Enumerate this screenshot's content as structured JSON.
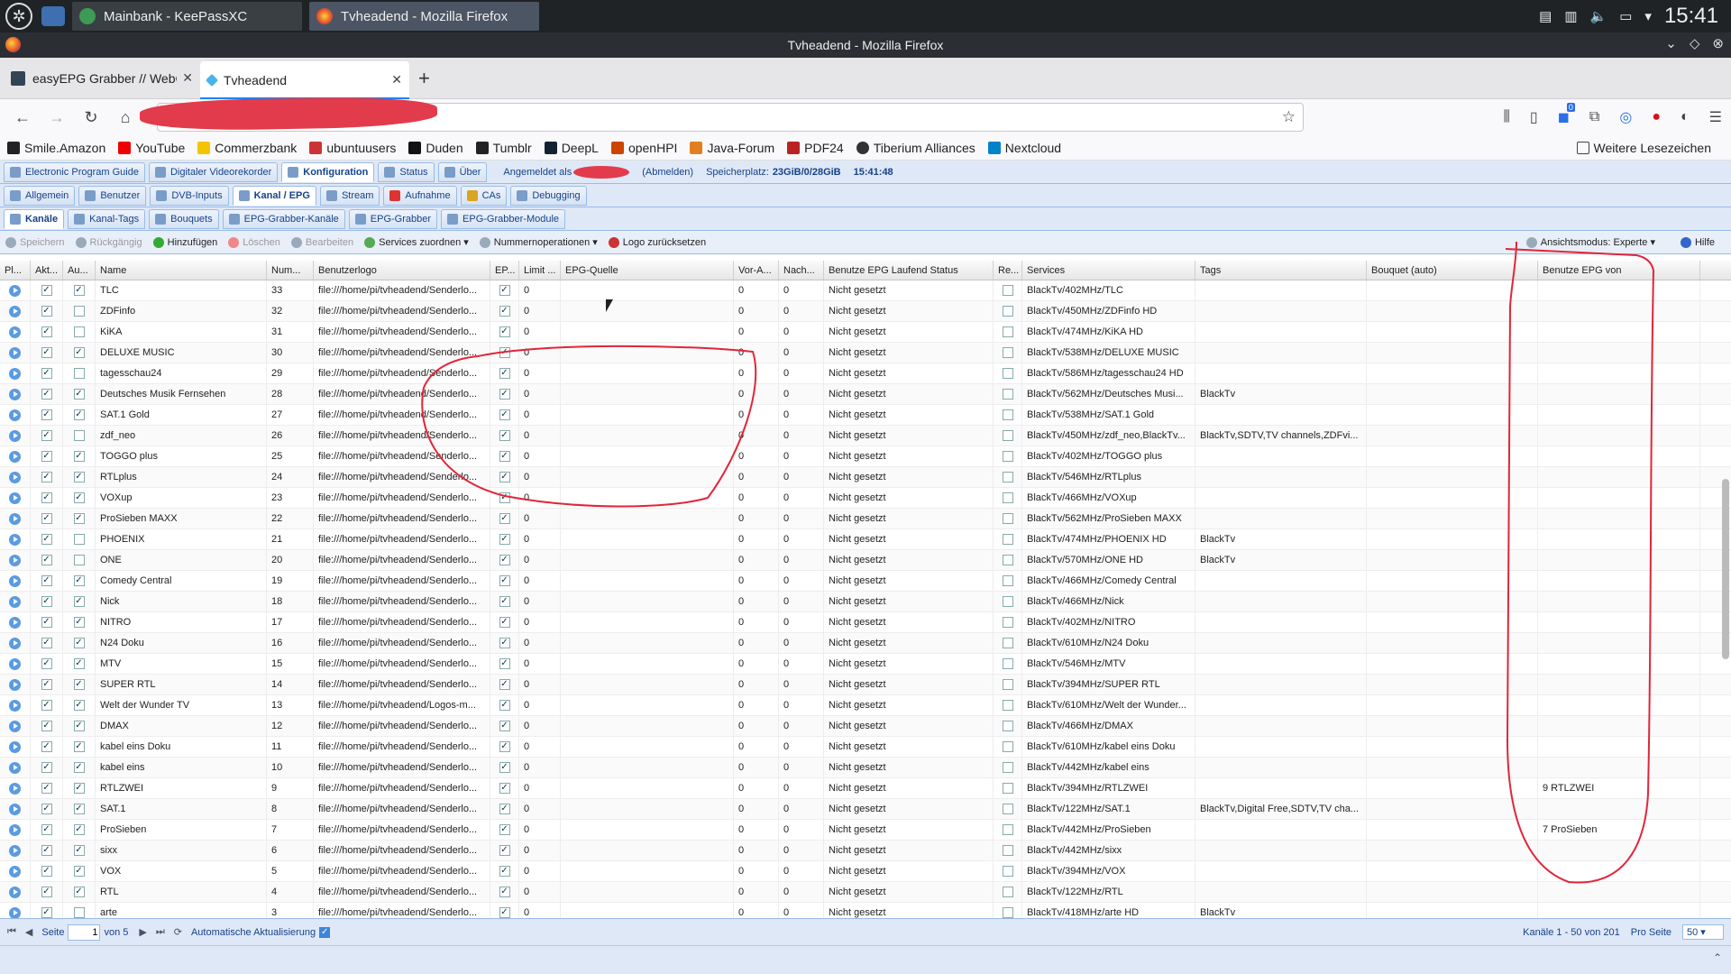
{
  "taskbar": {
    "tasks": [
      "Mainbank - KeePassXC",
      "Tvheadend - Mozilla Firefox"
    ],
    "clock": "15:41"
  },
  "window": {
    "title": "Tvheadend - Mozilla Firefox"
  },
  "browser": {
    "tabs": [
      "easyEPG Grabber // WebGr",
      "Tvheadend"
    ],
    "bookmarks": [
      "Smile.Amazon",
      "YouTube",
      "Commerzbank",
      "ubuntuusers",
      "Duden",
      "Tumblr",
      "DeepL",
      "openHPI",
      "Java-Forum",
      "PDF24",
      "Tiberium Alliances",
      "Nextcloud"
    ],
    "more_bookmarks": "Weitere Lesezeichen",
    "ext_badge": "0"
  },
  "tvh": {
    "main_tabs": [
      "Electronic Program Guide",
      "Digitaler Videorekorder",
      "Konfiguration",
      "Status",
      "Über"
    ],
    "login_label": "Angemeldet als",
    "logout": "(Abmelden)",
    "storage_label": "Speicherplatz:",
    "storage_value": "23GiB/0/28GiB",
    "time": "15:41:48",
    "config_tabs": [
      "Allgemein",
      "Benutzer",
      "DVB-Inputs",
      "Kanal / EPG",
      "Stream",
      "Aufnahme",
      "CAs",
      "Debugging"
    ],
    "sub_tabs": [
      "Kanäle",
      "Kanal-Tags",
      "Bouquets",
      "EPG-Grabber-Kanäle",
      "EPG-Grabber",
      "EPG-Grabber-Module"
    ],
    "toolbar": {
      "save": "Speichern",
      "undo": "Rückgängig",
      "add": "Hinzufügen",
      "delete": "Löschen",
      "edit": "Bearbeiten",
      "services": "Services zuordnen",
      "numops": "Nummernoperationen",
      "logo_reset": "Logo zurücksetzen",
      "view_mode": "Ansichtsmodus: Experte",
      "help": "Hilfe"
    },
    "columns": [
      "Pl...",
      "Akt...",
      "Au...",
      "Name",
      "Num...",
      "Benutzerlogo",
      "EP...",
      "Limit ...",
      "EPG-Quelle",
      "Vor-A...",
      "Nach...",
      "Benutze EPG Laufend Status",
      "Re...",
      "Services",
      "Tags",
      "Bouquet (auto)",
      "Benutze EPG von"
    ],
    "rows": [
      {
        "n": "TLC",
        "num": "33",
        "logo": "file:///home/pi/tvheadend/Senderlo...",
        "au": true,
        "svc": "BlackTv/402MHz/TLC",
        "tags": "",
        "epgvon": ""
      },
      {
        "n": "ZDFinfo",
        "num": "32",
        "logo": "file:///home/pi/tvheadend/Senderlo...",
        "au": false,
        "svc": "BlackTv/450MHz/ZDFinfo HD",
        "tags": "",
        "epgvon": ""
      },
      {
        "n": "KiKA",
        "num": "31",
        "logo": "file:///home/pi/tvheadend/Senderlo...",
        "au": false,
        "svc": "BlackTv/474MHz/KiKA HD",
        "tags": "",
        "epgvon": ""
      },
      {
        "n": "DELUXE MUSIC",
        "num": "30",
        "logo": "file:///home/pi/tvheadend/Senderlo...",
        "au": true,
        "svc": "BlackTv/538MHz/DELUXE MUSIC",
        "tags": "",
        "epgvon": ""
      },
      {
        "n": "tagesschau24",
        "num": "29",
        "logo": "file:///home/pi/tvheadend/Senderlo...",
        "au": false,
        "svc": "BlackTv/586MHz/tagesschau24 HD",
        "tags": "",
        "epgvon": ""
      },
      {
        "n": "Deutsches Musik Fernsehen",
        "num": "28",
        "logo": "file:///home/pi/tvheadend/Senderlo...",
        "au": true,
        "svc": "BlackTv/562MHz/Deutsches Musi...",
        "tags": "BlackTv",
        "epgvon": ""
      },
      {
        "n": "SAT.1 Gold",
        "num": "27",
        "logo": "file:///home/pi/tvheadend/Senderlo...",
        "au": true,
        "svc": "BlackTv/538MHz/SAT.1 Gold",
        "tags": "",
        "epgvon": ""
      },
      {
        "n": "zdf_neo",
        "num": "26",
        "logo": "file:///home/pi/tvheadend/Senderlo...",
        "au": false,
        "svc": "BlackTv/450MHz/zdf_neo,BlackTv...",
        "tags": "BlackTv,SDTV,TV channels,ZDFvi...",
        "epgvon": ""
      },
      {
        "n": "TOGGO plus",
        "num": "25",
        "logo": "file:///home/pi/tvheadend/Senderlo...",
        "au": true,
        "svc": "BlackTv/402MHz/TOGGO plus",
        "tags": "",
        "epgvon": ""
      },
      {
        "n": "RTLplus",
        "num": "24",
        "logo": "file:///home/pi/tvheadend/Senderlo...",
        "au": true,
        "svc": "BlackTv/546MHz/RTLplus",
        "tags": "",
        "epgvon": ""
      },
      {
        "n": "VOXup",
        "num": "23",
        "logo": "file:///home/pi/tvheadend/Senderlo...",
        "au": true,
        "svc": "BlackTv/466MHz/VOXup",
        "tags": "",
        "epgvon": ""
      },
      {
        "n": "ProSieben MAXX",
        "num": "22",
        "logo": "file:///home/pi/tvheadend/Senderlo...",
        "au": true,
        "svc": "BlackTv/562MHz/ProSieben MAXX",
        "tags": "",
        "epgvon": ""
      },
      {
        "n": "PHOENIX",
        "num": "21",
        "logo": "file:///home/pi/tvheadend/Senderlo...",
        "au": false,
        "svc": "BlackTv/474MHz/PHOENIX HD",
        "tags": "BlackTv",
        "epgvon": ""
      },
      {
        "n": "ONE",
        "num": "20",
        "logo": "file:///home/pi/tvheadend/Senderlo...",
        "au": false,
        "svc": "BlackTv/570MHz/ONE HD",
        "tags": "BlackTv",
        "epgvon": ""
      },
      {
        "n": "Comedy Central",
        "num": "19",
        "logo": "file:///home/pi/tvheadend/Senderlo...",
        "au": true,
        "svc": "BlackTv/466MHz/Comedy Central",
        "tags": "",
        "epgvon": ""
      },
      {
        "n": "Nick",
        "num": "18",
        "logo": "file:///home/pi/tvheadend/Senderlo...",
        "au": true,
        "svc": "BlackTv/466MHz/Nick",
        "tags": "",
        "epgvon": ""
      },
      {
        "n": "NITRO",
        "num": "17",
        "logo": "file:///home/pi/tvheadend/Senderlo...",
        "au": true,
        "svc": "BlackTv/402MHz/NITRO",
        "tags": "",
        "epgvon": ""
      },
      {
        "n": "N24 Doku",
        "num": "16",
        "logo": "file:///home/pi/tvheadend/Senderlo...",
        "au": true,
        "svc": "BlackTv/610MHz/N24 Doku",
        "tags": "",
        "epgvon": ""
      },
      {
        "n": "MTV",
        "num": "15",
        "logo": "file:///home/pi/tvheadend/Senderlo...",
        "au": true,
        "svc": "BlackTv/546MHz/MTV",
        "tags": "",
        "epgvon": ""
      },
      {
        "n": "SUPER RTL",
        "num": "14",
        "logo": "file:///home/pi/tvheadend/Senderlo...",
        "au": true,
        "svc": "BlackTv/394MHz/SUPER RTL",
        "tags": "",
        "epgvon": ""
      },
      {
        "n": "Welt der Wunder TV",
        "num": "13",
        "logo": "file:///home/pi/tvheadend/Logos-m...",
        "au": true,
        "svc": "BlackTv/610MHz/Welt der Wunder...",
        "tags": "",
        "epgvon": ""
      },
      {
        "n": "DMAX",
        "num": "12",
        "logo": "file:///home/pi/tvheadend/Senderlo...",
        "au": true,
        "svc": "BlackTv/466MHz/DMAX",
        "tags": "",
        "epgvon": ""
      },
      {
        "n": "kabel eins Doku",
        "num": "11",
        "logo": "file:///home/pi/tvheadend/Senderlo...",
        "au": true,
        "svc": "BlackTv/610MHz/kabel eins Doku",
        "tags": "",
        "epgvon": ""
      },
      {
        "n": "kabel eins",
        "num": "10",
        "logo": "file:///home/pi/tvheadend/Senderlo...",
        "au": true,
        "svc": "BlackTv/442MHz/kabel eins",
        "tags": "",
        "epgvon": ""
      },
      {
        "n": "RTLZWEI",
        "num": "9",
        "logo": "file:///home/pi/tvheadend/Senderlo...",
        "au": true,
        "svc": "BlackTv/394MHz/RTLZWEI",
        "tags": "",
        "epgvon": "9 RTLZWEI"
      },
      {
        "n": "SAT.1",
        "num": "8",
        "logo": "file:///home/pi/tvheadend/Senderlo...",
        "au": true,
        "svc": "BlackTv/122MHz/SAT.1",
        "tags": "BlackTv,Digital Free,SDTV,TV cha...",
        "epgvon": ""
      },
      {
        "n": "ProSieben",
        "num": "7",
        "logo": "file:///home/pi/tvheadend/Senderlo...",
        "au": true,
        "svc": "BlackTv/442MHz/ProSieben",
        "tags": "",
        "epgvon": "7 ProSieben"
      },
      {
        "n": "sixx",
        "num": "6",
        "logo": "file:///home/pi/tvheadend/Senderlo...",
        "au": true,
        "svc": "BlackTv/442MHz/sixx",
        "tags": "",
        "epgvon": ""
      },
      {
        "n": "VOX",
        "num": "5",
        "logo": "file:///home/pi/tvheadend/Senderlo...",
        "au": true,
        "svc": "BlackTv/394MHz/VOX",
        "tags": "",
        "epgvon": ""
      },
      {
        "n": "RTL",
        "num": "4",
        "logo": "file:///home/pi/tvheadend/Senderlo...",
        "au": true,
        "svc": "BlackTv/122MHz/RTL",
        "tags": "",
        "epgvon": ""
      },
      {
        "n": "arte",
        "num": "3",
        "logo": "file:///home/pi/tvheadend/Senderlo...",
        "au": false,
        "svc": "BlackTv/418MHz/arte HD",
        "tags": "BlackTv",
        "epgvon": ""
      }
    ],
    "cell_defaults": {
      "limit": "0",
      "pre": "0",
      "post": "0",
      "status": "Nicht gesetzt"
    },
    "pager": {
      "page_label": "Seite",
      "page": "1",
      "of": "von 5",
      "auto_refresh": "Automatische Aktualisierung",
      "range": "Kanäle 1 - 50 von 201",
      "per_page_label": "Pro Seite",
      "per_page": "50"
    }
  },
  "colors": {
    "annotation": "#e0263a",
    "ext_blue": "#2a6ee8",
    "ext_red": "#d3141e",
    "accent": "#0a84ff"
  }
}
